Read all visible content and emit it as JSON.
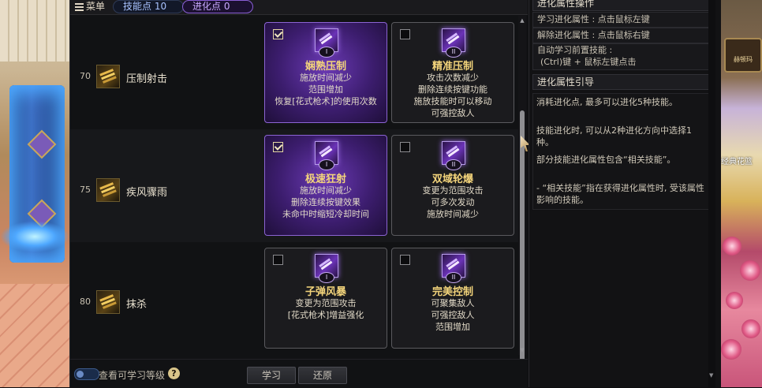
{
  "topbar": {
    "menu_label": "菜单",
    "skill_points_label": "技能点 10",
    "evo_points_label": "进化点 0"
  },
  "rows": [
    {
      "level": "70",
      "name": "压制射击",
      "icon": "suppress-shot-icon",
      "options": [
        {
          "number": "I",
          "title": "娴熟压制",
          "selected": true,
          "checked": true,
          "desc": [
            "施放时间减少",
            "范围增加",
            "恢复[花式枪术]的使用次数"
          ]
        },
        {
          "number": "II",
          "title": "精准压制",
          "selected": false,
          "checked": false,
          "desc": [
            "攻击次数减少",
            "删除连续按键功能",
            "施放技能时可以移动",
            "可强控敌人"
          ]
        }
      ]
    },
    {
      "level": "75",
      "name": "疾风骤雨",
      "icon": "bullet-storm-icon",
      "options": [
        {
          "number": "I",
          "title": "极速狂射",
          "selected": true,
          "checked": true,
          "desc": [
            "施放时间减少",
            "删除连续按键效果",
            "未命中时缩短冷却时间"
          ]
        },
        {
          "number": "II",
          "title": "双域轮爆",
          "selected": false,
          "checked": false,
          "desc": [
            "变更为范围攻击",
            "可多次发动",
            "施放时间减少"
          ]
        }
      ]
    },
    {
      "level": "80",
      "name": "抹杀",
      "icon": "obliterate-icon",
      "options": [
        {
          "number": "I",
          "title": "子弹风暴",
          "selected": false,
          "checked": false,
          "desc": [
            "变更为范围攻击",
            "[花式枪术]增益强化"
          ]
        },
        {
          "number": "II",
          "title": "完美控制",
          "selected": false,
          "checked": false,
          "desc": [
            "可聚集敌人",
            "可强控敌人",
            "范围增加"
          ]
        }
      ]
    }
  ],
  "bottom": {
    "toggle_label": "查看可学习等级",
    "help": "?",
    "learn_button": "学习",
    "reset_button": "还原"
  },
  "info": {
    "ops_header": "进化属性操作",
    "learn_line": "学习进化属性 : 点击鼠标左键",
    "remove_line": "解除进化属性 : 点击鼠标右键",
    "auto_line1": "自动学习前置技能 :",
    "auto_line2": "(Ctrl)键 + 鼠标左键点击",
    "guide_header": "进化属性引导",
    "guide": [
      "消耗进化点, 最多可以进化5种技能。",
      "技能进化时, 可以从2种进化方向中选择1种。",
      "部分技能进化属性包含“相关技能”。",
      "- “相关技能”指在获得进化属性时, 受该属性影响的技能。"
    ]
  },
  "backdrop": {
    "right_sign": "赫顿玛",
    "right_banner": "经典花篮"
  },
  "colors": {
    "selected_card": "#6b3ab5",
    "title_gold": "#f3d47b",
    "skill_points": "#a9c3ff",
    "evo_points": "#c9a9ff"
  }
}
